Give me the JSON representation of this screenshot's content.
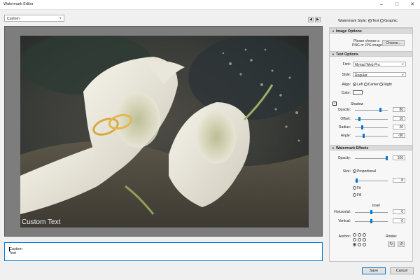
{
  "window": {
    "title": "Watermark Editor"
  },
  "top": {
    "preset_value": "Custom",
    "watermark_style_label": "Watermark Style:",
    "style_text": "Text",
    "style_graphic": "Graphic"
  },
  "preview": {
    "watermark_text": "Custom Text"
  },
  "text_input": {
    "value": "Custom Text"
  },
  "panel": {
    "image_options": {
      "header": "Image Options",
      "hint_line1": "Please choose a",
      "hint_line2": "PNG or JPG image",
      "choose_label": "Choose..."
    },
    "text_options": {
      "header": "Text Options",
      "font_label": "Font:",
      "font_value": "Myriad Web Pro",
      "style_label": "Style:",
      "style_value": "Regular",
      "align_label": "Align:",
      "align_left": "Left",
      "align_center": "Center",
      "align_right": "Right",
      "color_label": "Color:",
      "color_value": "#ffffff"
    },
    "shadow": {
      "label": "Shadow",
      "enabled": true,
      "opacity_label": "Opacity:",
      "opacity_value": "80",
      "offset_label": "Offset:",
      "offset_value": "10",
      "radius_label": "Radius:",
      "radius_value": "20",
      "angle_label": "Angle:",
      "angle_value": "-90"
    },
    "effects": {
      "header": "Watermark Effects",
      "opacity_label": "Opacity:",
      "opacity_value": "100",
      "size_label": "Size:",
      "proportional": "Proportional",
      "size_value": "8",
      "fit": "Fit",
      "fill": "Fill",
      "inset_label": "Inset",
      "horizontal_label": "Horizontal:",
      "horizontal_value": "0",
      "vertical_label": "Vertical:",
      "vertical_value": "0",
      "anchor_label": "Anchor:",
      "rotate_label": "Rotate:"
    }
  },
  "buttons": {
    "save": "Save",
    "cancel": "Cancel"
  },
  "icons": {
    "minimize": "minimize-icon",
    "maximize": "maximize-icon",
    "close": "close-icon",
    "prev": "triangle-left-icon",
    "next": "triangle-right-icon",
    "rotate_cw": "rotate-clockwise-icon",
    "rotate_ccw": "rotate-counterclockwise-icon"
  },
  "colors": {
    "accent": "#0078d7",
    "preview_bg": "#7d7d7d"
  }
}
